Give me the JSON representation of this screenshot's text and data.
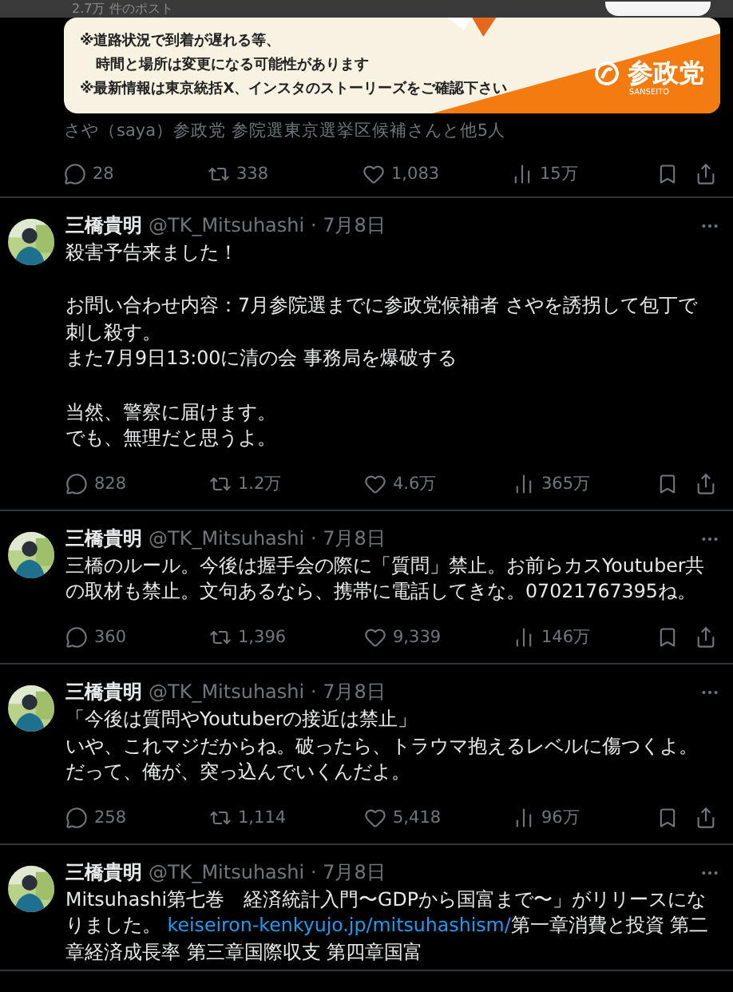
{
  "header": {
    "title": "2.7万 件のポスト"
  },
  "quoted_post": {
    "kind": "picture",
    "lines": [
      "※道路状況で到着が遅れる等、",
      "時間と場所は変更になる可能性があります",
      "※最新情報は東京統括X、インスタのストーリーズをご確認下さい"
    ],
    "logo": "参政党",
    "logo_sub": "SANSEITO",
    "tagged": "さや（saya）参政党 参院選東京選挙区候補さんと他5人",
    "stats": {
      "replies": "28",
      "reposts": "338",
      "likes": "1,083",
      "views": "15万"
    }
  },
  "posts": [
    {
      "name": "三橋貴明",
      "handle": "@TK_Mitsuhashi",
      "separator": "·",
      "date": "7月8日",
      "lines": [
        {
          "text": "殺害予告来ました！",
          "gap": false
        },
        {
          "text": "お問い合わせ内容：7月参院選までに参政党候補者 さやを誘拐して包丁で刺し殺す。",
          "gap": true
        },
        {
          "text": "また7月9日13:00に清の会 事務局を爆破する",
          "gap": false
        },
        {
          "text": "当然、警察に届けます。",
          "gap": true
        },
        {
          "text": "でも、無理だと思うよ。",
          "gap": false
        }
      ],
      "stats": {
        "replies": "828",
        "reposts": "1.2万",
        "likes": "4.6万",
        "views": "365万"
      }
    },
    {
      "name": "三橋貴明",
      "handle": "@TK_Mitsuhashi",
      "separator": "·",
      "date": "7月8日",
      "lines": [
        {
          "text": "三橋のルール。今後は握手会の際に「質問」禁止。お前らカスYoutuber共の取材も禁止。文句あるなら、携帯に電話してきな。07021767395ね。",
          "gap": false
        }
      ],
      "stats": {
        "replies": "360",
        "reposts": "1,396",
        "likes": "9,339",
        "views": "146万"
      }
    },
    {
      "name": "三橋貴明",
      "handle": "@TK_Mitsuhashi",
      "separator": "·",
      "date": "7月8日",
      "lines": [
        {
          "text": "「今後は質問やYoutuberの接近は禁止」",
          "gap": false
        },
        {
          "text": "いや、これマジだからね。破ったら、トラウマ抱えるレベルに傷つくよ。だって、俺が、突っ込んでいくんだよ。",
          "gap": false
        }
      ],
      "stats": {
        "replies": "258",
        "reposts": "1,114",
        "likes": "5,418",
        "views": "96万"
      }
    },
    {
      "name": "三橋貴明",
      "handle": "@TK_Mitsuhashi",
      "separator": "·",
      "date": "7月8日",
      "lines": [
        {
          "gap": false,
          "segments": [
            {
              "kind": "text",
              "text": "Mitsuhashi第七巻　経済統計入門〜GDPから国富まで〜」がリリースになりました。 "
            },
            {
              "kind": "link",
              "text": "keiseiron-kenkyujo.jp/mitsuhashism/"
            },
            {
              "kind": "text",
              "text": "第一章消費と投資 第二章経済成長率 第三章国際収支 第四章国富"
            }
          ]
        }
      ]
    }
  ]
}
